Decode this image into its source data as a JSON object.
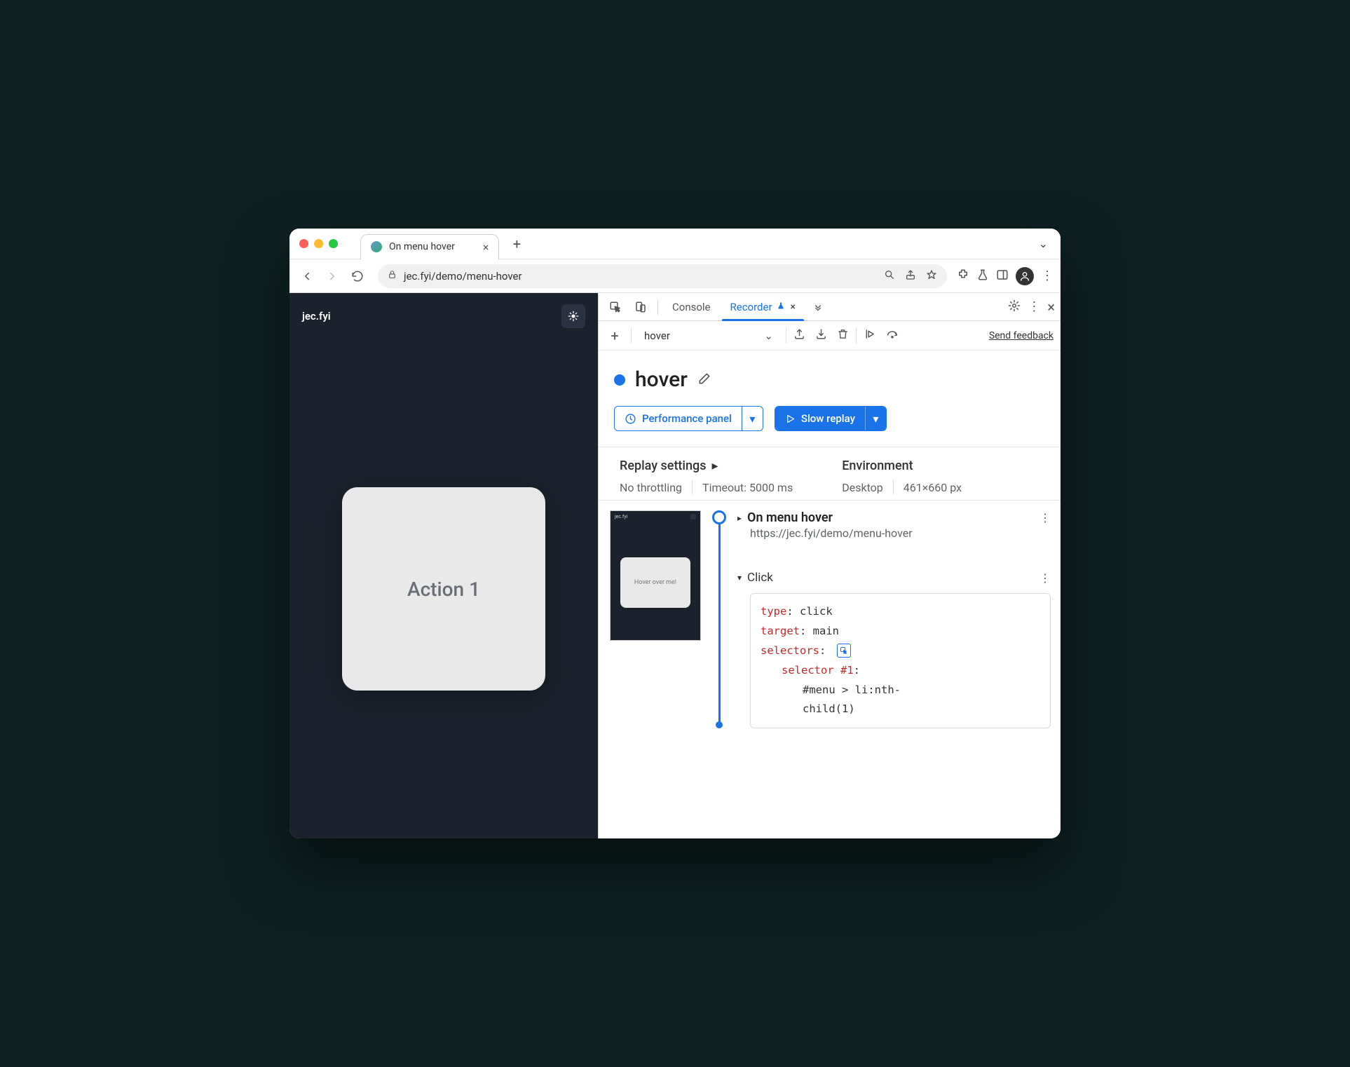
{
  "tab": {
    "title": "On menu hover"
  },
  "address": {
    "url": "jec.fyi/demo/menu-hover"
  },
  "page": {
    "brand": "jec.fyi",
    "card_label": "Action 1"
  },
  "devtools": {
    "tabs": {
      "console": "Console",
      "recorder": "Recorder"
    },
    "toolbar": {
      "recording_name": "hover",
      "feedback": "Send feedback"
    },
    "recording": {
      "title": "hover",
      "performance_btn": "Performance panel",
      "replay_btn": "Slow replay"
    },
    "settings": {
      "replay_title": "Replay settings",
      "throttling": "No throttling",
      "timeout": "Timeout: 5000 ms",
      "env_title": "Environment",
      "device": "Desktop",
      "viewport": "461×660 px"
    },
    "thumbnail": {
      "brand": "jec.fyi",
      "card": "Hover over me!"
    },
    "steps": {
      "nav": {
        "title": "On menu hover",
        "url": "https://jec.fyi/demo/menu-hover"
      },
      "click": {
        "title": "Click",
        "code": {
          "k_type": "type",
          "v_type": "click",
          "k_target": "target",
          "v_target": "main",
          "k_selectors": "selectors",
          "k_sel1": "selector #1",
          "v_sel1a": "#menu > li:nth-",
          "v_sel1b": "child(1)"
        }
      }
    }
  }
}
